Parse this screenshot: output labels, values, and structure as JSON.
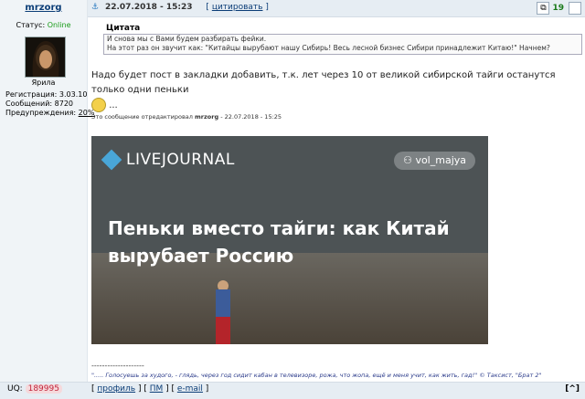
{
  "user": {
    "name": "mrzorg",
    "status_label": "Статус:",
    "status_value": "Online",
    "rank": "Ярила",
    "stats": {
      "reg_label": "Регистрация:",
      "reg_value": "3.03.10",
      "msgs_label": "Сообщений:",
      "msgs_value": "8720",
      "warn_label": "Предупреждения:",
      "warn_value": "20%"
    }
  },
  "post": {
    "date": "22.07.2018 - 15:23",
    "cite_open": "[",
    "cite_label": "цитировать",
    "cite_close": "]",
    "number": "19",
    "quote_title": "Цитата",
    "quote_line1": "И снова мы с Вами будем разбирать фейки.",
    "quote_line2": "На этот раз он звучит как: \"Китайцы вырубают нашу Сибирь! Весь лесной бизнес Сибири принадлежит Китаю!\" Начнем?",
    "text": "Надо будет пост в закладки добавить, т.к. лет через 10 от великой сибирской тайги останутся только одни пеньки",
    "ellipsis": "...",
    "edited_prefix": "Это сообщение отредактировал",
    "edited_user": "mrzorg",
    "edited_date": "- 22.07.2018 - 15:25",
    "image": {
      "logo_text": "LIVEJOURNAL",
      "user_tag": "vol_majya",
      "headline": "Пеньки вместо тайги: как Китай вырубает Россию"
    },
    "sig_line": "--------------------",
    "signature": "\"..... Голосуешь за худого, - глядь, через год сидит кабан в телевизоре, рожа, что жопа, ещё и меня учит, как жить, гад!\" © Таксист, \"Брат 2\""
  },
  "bottom": {
    "uq_label": "UQ:",
    "uq_value": "189995",
    "profile": "профиль",
    "pm": "ПМ",
    "email": "e-mail",
    "to_top": "[^]"
  },
  "icons": {
    "anchor": "anchor-icon",
    "copy": "copy-icon",
    "checkbox": "select-post-checkbox"
  }
}
